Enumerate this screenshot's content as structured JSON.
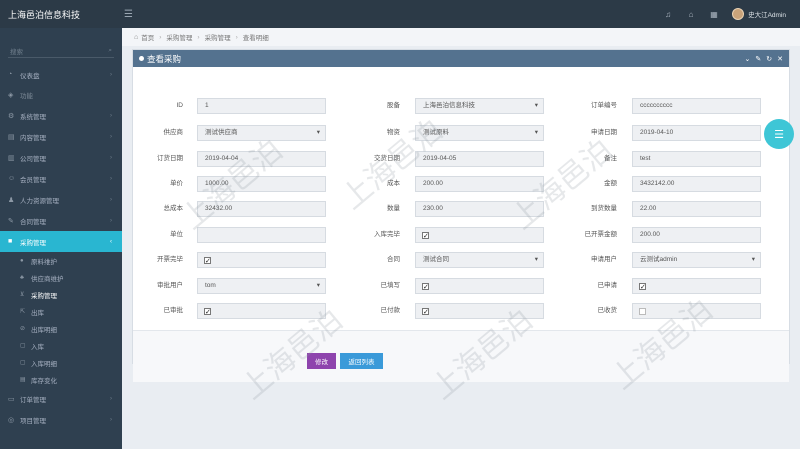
{
  "app": {
    "title": "上海邑泊信息科技",
    "user_name": "史大江Admin"
  },
  "topbar": {
    "icons": [
      "bell-icon",
      "home-icon",
      "calendar-icon"
    ]
  },
  "sidebar": {
    "search_placeholder": "搜索",
    "items": [
      {
        "label": "仪表盘",
        "icon": "dashboard-icon"
      },
      {
        "label": "功能",
        "icon": "function-icon"
      },
      {
        "label": "系统管理",
        "icon": "settings-icon"
      },
      {
        "label": "内容管理",
        "icon": "content-icon"
      },
      {
        "label": "公司管理",
        "icon": "company-icon"
      },
      {
        "label": "会员管理",
        "icon": "member-icon"
      },
      {
        "label": "人力资源管理",
        "icon": "hr-icon"
      },
      {
        "label": "合同管理",
        "icon": "contract-icon"
      },
      {
        "label": "采购管理",
        "icon": "purchase-icon"
      }
    ],
    "sub_items": [
      {
        "label": "原料维护",
        "icon": "material-icon"
      },
      {
        "label": "供应商维护",
        "icon": "supplier-icon"
      },
      {
        "label": "采购管理",
        "icon": "cart-icon"
      },
      {
        "label": "出库",
        "icon": "outbound-icon"
      },
      {
        "label": "出库明细",
        "icon": "outbound-detail-icon"
      },
      {
        "label": "入库",
        "icon": "inbound-icon"
      },
      {
        "label": "入库明细",
        "icon": "inbound-detail-icon"
      },
      {
        "label": "库存变化",
        "icon": "stock-icon"
      }
    ],
    "bottom_items": [
      {
        "label": "订单管理",
        "icon": "order-icon"
      },
      {
        "label": "项目管理",
        "icon": "project-icon"
      }
    ]
  },
  "breadcrumb": [
    "首页",
    "采购管理",
    "采购管理",
    "查看明细"
  ],
  "panel": {
    "title": "查看采购"
  },
  "form": {
    "id_label": "ID",
    "id_value": "1",
    "company_label": "股备",
    "company_value": "上海邑泊信息科技",
    "order_no_label": "订单编号",
    "order_no_value": "cccccccccc",
    "supplier_label": "供应商",
    "supplier_value": "测试供应商",
    "material_label": "物资",
    "material_value": "测试原料",
    "apply_date_label": "申请日期",
    "apply_date_value": "2019-04-10",
    "order_date_label": "订货日期",
    "order_date_value": "2019-04-04",
    "delivery_date_label": "交货日期",
    "delivery_date_value": "2019-04-05",
    "remark_label": "备注",
    "remark_value": "test",
    "unit_price_label": "单价",
    "unit_price_value": "1000.00",
    "cost_label": "成本",
    "cost_value": "200.00",
    "amount_label": "金额",
    "amount_value": "3432142.00",
    "total_cost_label": "总成本",
    "total_cost_value": "32432.00",
    "quantity_label": "数量",
    "quantity_value": "230.00",
    "arrived_qty_label": "到货数量",
    "arrived_qty_value": "22.00",
    "unit_label": "单位",
    "unit_value": "",
    "stocked_label": "入库完毕",
    "stocked_checked": true,
    "invoiced_amount_label": "已开票金额",
    "invoiced_amount_value": "200.00",
    "invoice_done_label": "开票完毕",
    "invoice_done_checked": true,
    "contract_label": "合同",
    "contract_value": "测试合同",
    "applicant_label": "申请用户",
    "applicant_value": "云测试admin",
    "reviewer_label": "审批用户",
    "reviewer_value": "tom",
    "filled_label": "已填写",
    "filled_checked": true,
    "applied_label": "已申请",
    "applied_checked": true,
    "reviewed_label": "已审批",
    "reviewed_checked": true,
    "paid_label": "已付款",
    "paid_checked": true,
    "received_label": "已收货",
    "received_checked": false
  },
  "buttons": {
    "edit": "修改",
    "back": "返回列表"
  },
  "watermark": "上海邑泊",
  "colors": {
    "topbar": "#2c3a47",
    "sidebar": "#2f4050",
    "active": "#29b6d1",
    "panel_header": "#54728f",
    "edit_button": "#8e44ad",
    "back_button": "#3a9ad9"
  }
}
